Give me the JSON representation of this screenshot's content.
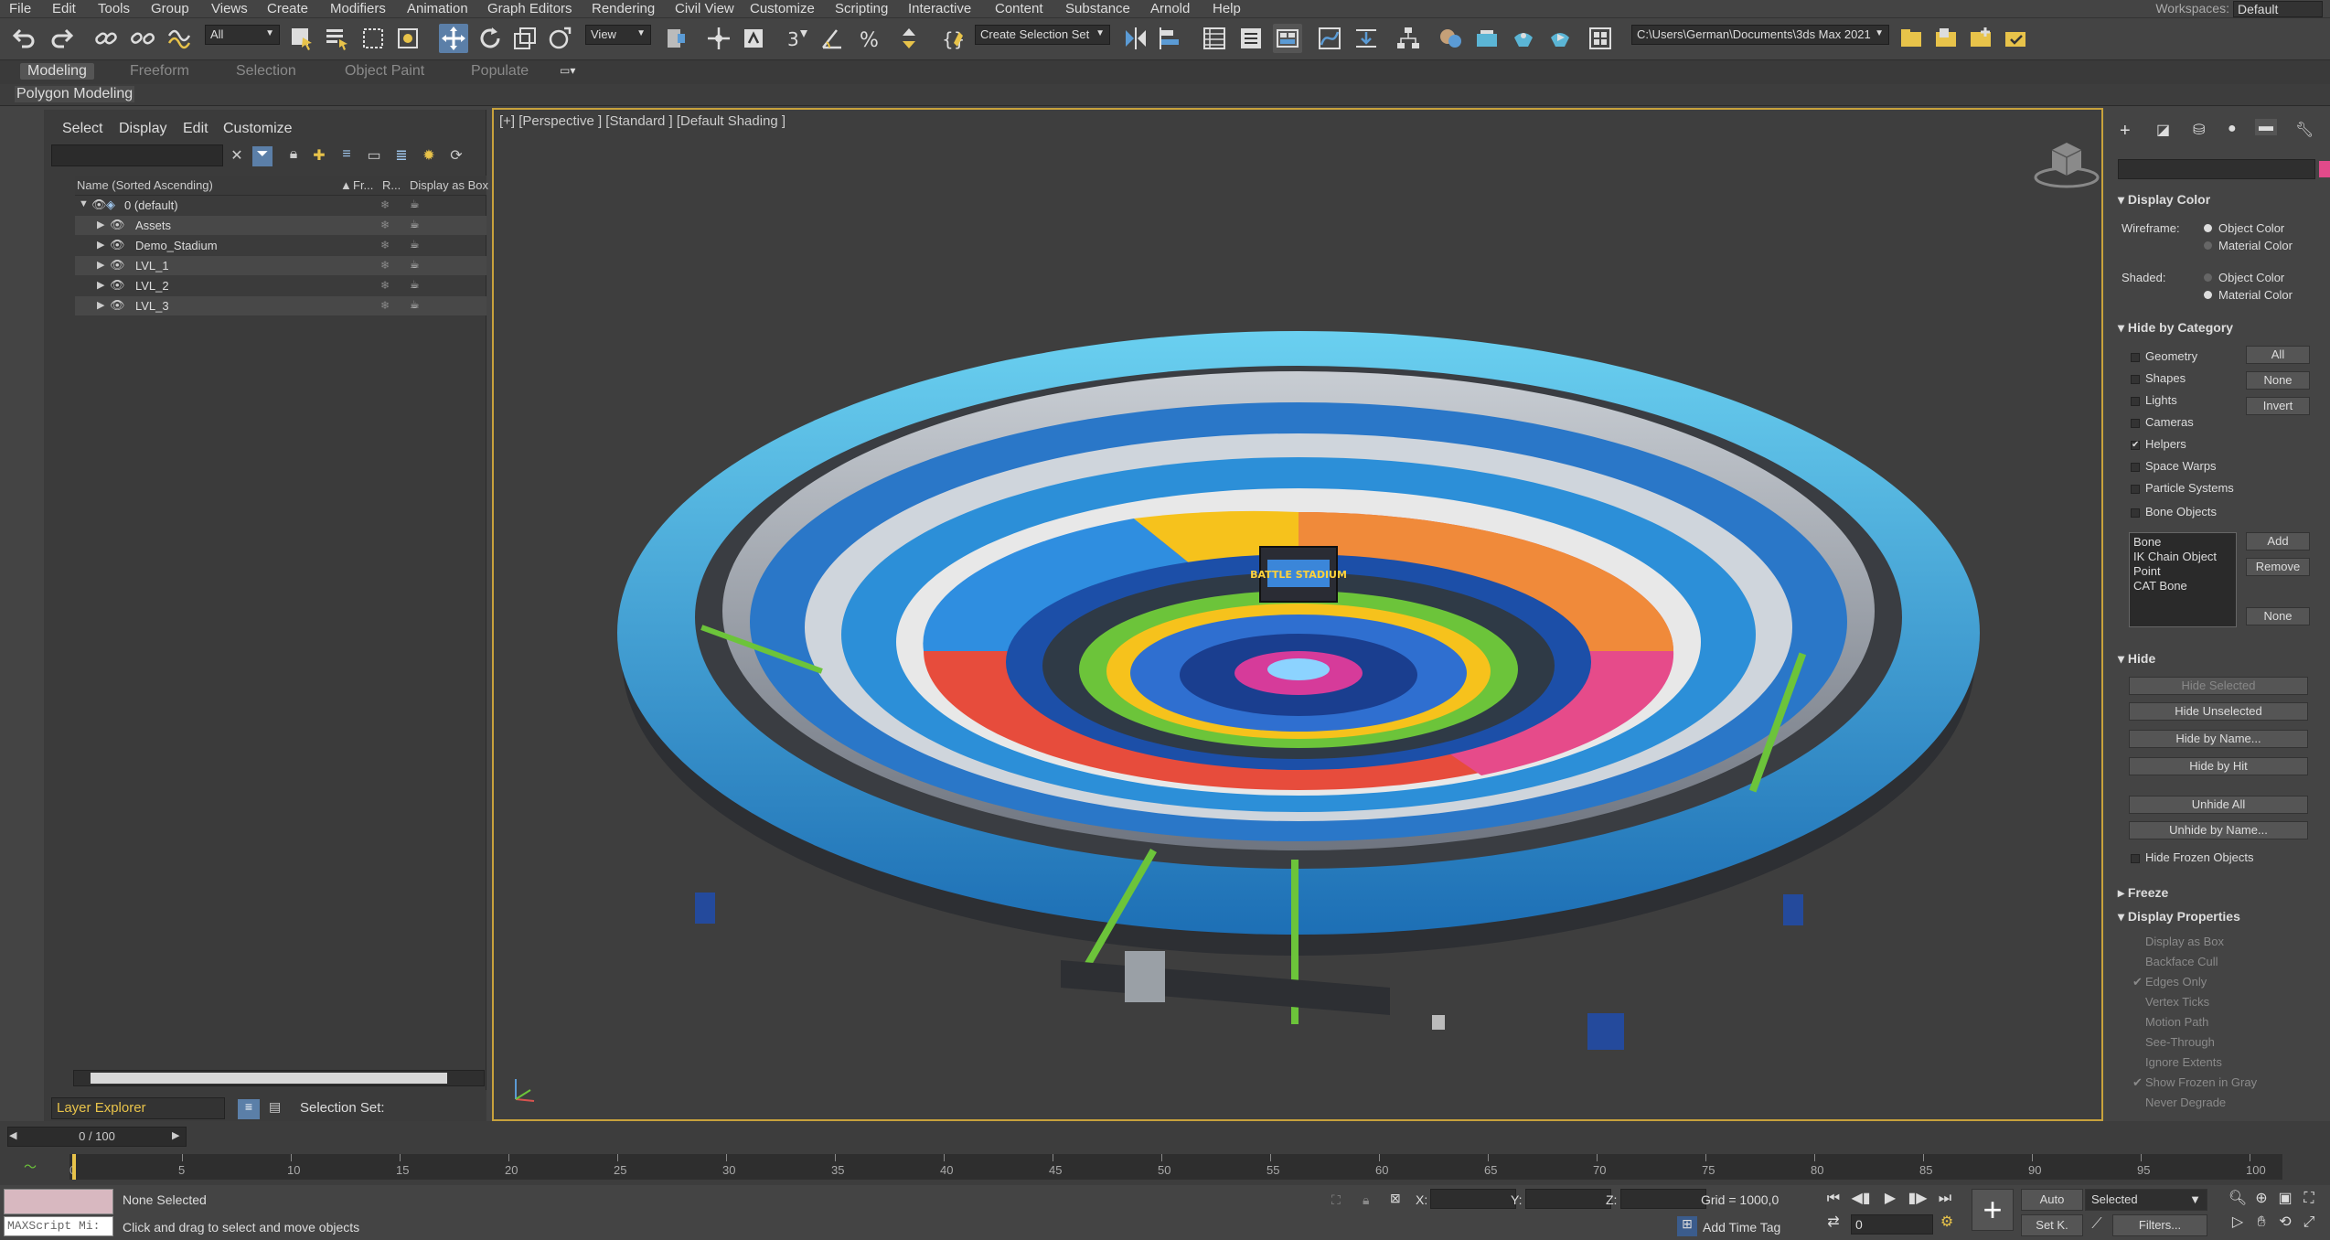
{
  "menubar": {
    "items": [
      "File",
      "Edit",
      "Tools",
      "Group",
      "Views",
      "Create",
      "Modifiers",
      "Animation",
      "Graph Editors",
      "Rendering",
      "Civil View",
      "Customize",
      "Scripting",
      "Interactive",
      "Content",
      "Substance",
      "Arnold",
      "Help"
    ],
    "workspaces_label": "Workspaces:",
    "workspaces_value": "Default"
  },
  "toolbar": {
    "filter_value": "All",
    "refcoord_value": "View",
    "selection_set": "Create Selection Set",
    "project_path": "C:\\Users\\German\\Documents\\3ds Max 2021"
  },
  "ribbon": {
    "tabs": [
      "Modeling",
      "Freeform",
      "Selection",
      "Object Paint",
      "Populate"
    ],
    "active_tab": "Modeling",
    "sub_label": "Polygon Modeling"
  },
  "explorer": {
    "menus": [
      "Select",
      "Display",
      "Edit",
      "Customize"
    ],
    "search_placeholder": "",
    "columns": {
      "name": "Name (Sorted Ascending)",
      "fr": "Fr...",
      "r": "R...",
      "box": "Display as Box"
    },
    "rows": [
      {
        "label": "0 (default)"
      },
      {
        "label": "Assets"
      },
      {
        "label": "Demo_Stadium"
      },
      {
        "label": "LVL_1"
      },
      {
        "label": "LVL_2"
      },
      {
        "label": "LVL_3"
      }
    ],
    "footer_select": "Layer Explorer",
    "selection_set_label": "Selection Set:"
  },
  "viewport": {
    "label": "[+] [Perspective ] [Standard ] [Default Shading ]",
    "stadium_sign": "BATTLE STADIUM"
  },
  "command_panel": {
    "display_color": {
      "title": "Display Color",
      "wireframe_label": "Wireframe:",
      "shaded_label": "Shaded:",
      "object_color": "Object Color",
      "material_color": "Material Color"
    },
    "hide_by_category": {
      "title": "Hide by Category",
      "items": [
        "Geometry",
        "Shapes",
        "Lights",
        "Cameras",
        "Helpers",
        "Space Warps",
        "Particle Systems",
        "Bone Objects"
      ],
      "checked": "Helpers",
      "buttons": [
        "All",
        "None",
        "Invert"
      ],
      "list": [
        "Bone",
        "IK Chain Object",
        "Point",
        "CAT Bone"
      ],
      "add": "Add",
      "remove": "Remove",
      "none": "None"
    },
    "hide": {
      "title": "Hide",
      "buttons": [
        "Hide Selected",
        "Hide Unselected",
        "Hide by Name...",
        "Hide by Hit",
        "Unhide All",
        "Unhide by Name..."
      ],
      "hide_frozen": "Hide Frozen Objects"
    },
    "freeze": {
      "title": "Freeze"
    },
    "display_properties": {
      "title": "Display Properties",
      "items": [
        "Display as Box",
        "Backface Cull",
        "Edges Only",
        "Vertex Ticks",
        "Motion Path",
        "See-Through",
        "Ignore Extents",
        "Show Frozen in Gray",
        "Never Degrade"
      ]
    }
  },
  "timeline": {
    "slider": "0 / 100",
    "ticks": [
      "0",
      "5",
      "10",
      "15",
      "20",
      "25",
      "30",
      "35",
      "40",
      "45",
      "50",
      "55",
      "60",
      "65",
      "70",
      "75",
      "80",
      "85",
      "90",
      "95",
      "100"
    ]
  },
  "status": {
    "maxscript": "MAXScript Mi:",
    "selected_text": "None Selected",
    "prompt": "Click and drag to select and move objects",
    "x_label": "X:",
    "y_label": "Y:",
    "z_label": "Z:",
    "grid": "Grid = 1000,0",
    "add_time_tag": "Add Time Tag",
    "auto": "Auto",
    "set_k": "Set K.",
    "selected_dd": "Selected",
    "filters": "Filters...",
    "frame": "0"
  }
}
